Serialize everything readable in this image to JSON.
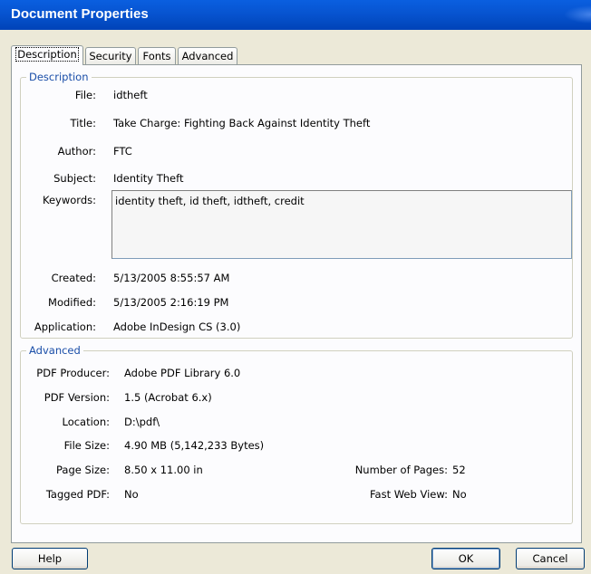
{
  "window": {
    "title": "Document Properties"
  },
  "tabs": [
    "Description",
    "Security",
    "Fonts",
    "Advanced"
  ],
  "active_tab": "Description",
  "description": {
    "legend": "Description",
    "file_label": "File:",
    "file": "idtheft",
    "title_label": "Title:",
    "title": "Take Charge: Fighting Back Against Identity Theft",
    "author_label": "Author:",
    "author": "FTC",
    "subject_label": "Subject:",
    "subject": "Identity Theft",
    "keywords_label": "Keywords:",
    "keywords": "identity theft, id theft, idtheft, credit",
    "created_label": "Created:",
    "created": "5/13/2005 8:55:57 AM",
    "modified_label": "Modified:",
    "modified": "5/13/2005 2:16:19 PM",
    "application_label": "Application:",
    "application": "Adobe InDesign CS (3.0)"
  },
  "advanced": {
    "legend": "Advanced",
    "producer_label": "PDF Producer:",
    "producer": "Adobe PDF Library 6.0",
    "version_label": "PDF Version:",
    "version": "1.5 (Acrobat 6.x)",
    "location_label": "Location:",
    "location": "D:\\pdf\\",
    "filesize_label": "File Size:",
    "filesize": "4.90 MB (5,142,233 Bytes)",
    "pagesize_label": "Page Size:",
    "pagesize": "8.50 x 11.00 in",
    "tagged_label": "Tagged PDF:",
    "tagged": "No",
    "pages_label": "Number of Pages:",
    "pages": "52",
    "fastweb_label": "Fast Web View:",
    "fastweb": "No"
  },
  "buttons": {
    "help": "Help",
    "ok": "OK",
    "cancel": "Cancel"
  }
}
